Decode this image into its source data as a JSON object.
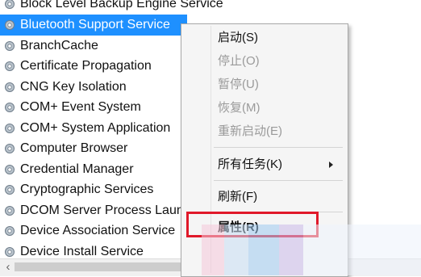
{
  "services": [
    {
      "name": "Block Level Backup Engine Service",
      "selected": false
    },
    {
      "name": "Bluetooth Support Service",
      "selected": true
    },
    {
      "name": "BranchCache",
      "selected": false
    },
    {
      "name": "Certificate Propagation",
      "selected": false
    },
    {
      "name": "CNG Key Isolation",
      "selected": false
    },
    {
      "name": "COM+ Event System",
      "selected": false
    },
    {
      "name": "COM+ System Application",
      "selected": false
    },
    {
      "name": "Computer Browser",
      "selected": false
    },
    {
      "name": "Credential Manager",
      "selected": false
    },
    {
      "name": "Cryptographic Services",
      "selected": false
    },
    {
      "name": "DCOM Server Process Launcher",
      "selected": false
    },
    {
      "name": "Device Association Service",
      "selected": false
    },
    {
      "name": "Device Install Service",
      "selected": false
    }
  ],
  "service_icon": "gear-icon",
  "context_menu": {
    "items": [
      {
        "label": "启动(S)",
        "enabled": true
      },
      {
        "label": "停止(O)",
        "enabled": false
      },
      {
        "label": "暂停(U)",
        "enabled": false
      },
      {
        "label": "恢复(M)",
        "enabled": false
      },
      {
        "label": "重新启动(E)",
        "enabled": false
      },
      {
        "label": "所有任务(K)",
        "enabled": true,
        "submenu": true
      },
      {
        "label": "刷新(F)",
        "enabled": true
      },
      {
        "label": "属性(R)",
        "enabled": true,
        "highlighted": true
      }
    ]
  },
  "colors": {
    "selection": "#1e90ff",
    "highlight_box": "#e0192a",
    "disabled_text": "#9a9a9a"
  }
}
